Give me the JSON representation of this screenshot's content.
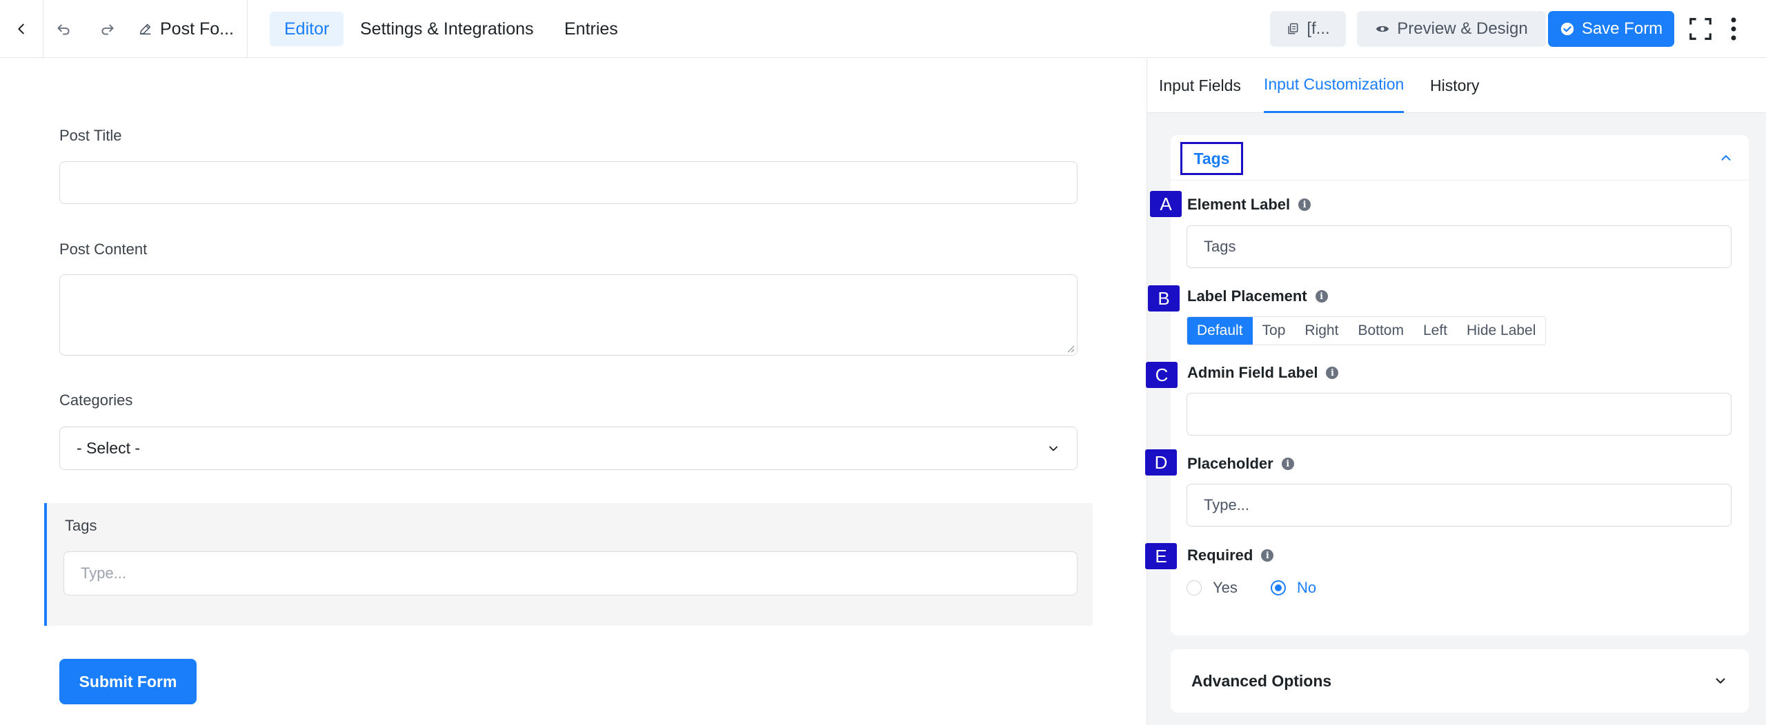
{
  "topbar": {
    "form_title": "Post Fo...",
    "nav_tabs": [
      {
        "label": "Editor",
        "active": true
      },
      {
        "label": "Settings & Integrations",
        "active": false
      },
      {
        "label": "Entries",
        "active": false
      }
    ],
    "shortcode_label": "[f...",
    "preview_label": "Preview & Design",
    "save_label": "Save Form"
  },
  "form": {
    "fields": [
      {
        "label": "Post Title",
        "value": ""
      },
      {
        "label": "Post Content",
        "value": ""
      }
    ],
    "categories": {
      "label": "Categories",
      "value": "- Select -"
    },
    "tags": {
      "label": "Tags",
      "placeholder": "Type..."
    },
    "submit_label": "Submit Form"
  },
  "panel": {
    "tabs": [
      {
        "label": "Input Fields",
        "active": false
      },
      {
        "label": "Input Customization",
        "active": true
      },
      {
        "label": "History",
        "active": false
      }
    ],
    "section_title": "Tags",
    "markers": [
      "A",
      "B",
      "C",
      "D",
      "E"
    ],
    "element_label": {
      "label": "Element Label",
      "value": "Tags"
    },
    "label_placement": {
      "label": "Label Placement",
      "options": [
        "Default",
        "Top",
        "Right",
        "Bottom",
        "Left",
        "Hide Label"
      ],
      "selected": "Default"
    },
    "admin_field_label": {
      "label": "Admin Field Label",
      "value": ""
    },
    "placeholder": {
      "label": "Placeholder",
      "value": "Type..."
    },
    "required": {
      "label": "Required",
      "options": [
        "Yes",
        "No"
      ],
      "selected": "No"
    },
    "advanced_options": "Advanced Options"
  },
  "colors": {
    "accent": "#1a7efb",
    "marker": "#1a0fc4",
    "panel_bg": "#f3f4f6"
  }
}
